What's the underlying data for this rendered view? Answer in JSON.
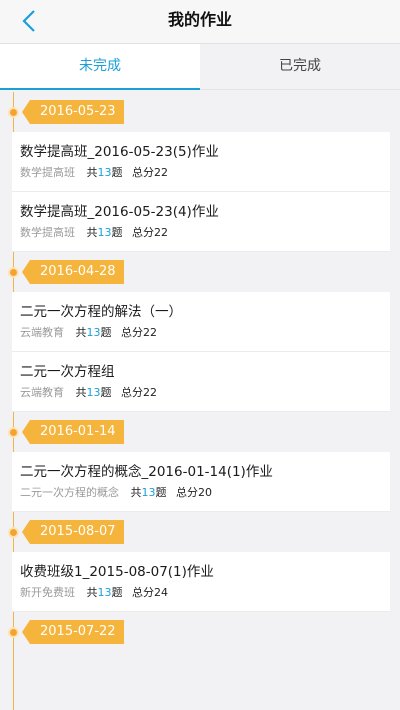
{
  "header": {
    "title": "我的作业"
  },
  "tabs": [
    {
      "label": "未完成",
      "active": true
    },
    {
      "label": "已完成",
      "active": false
    }
  ],
  "colors": {
    "accent": "#1aa0d8",
    "date_badge": "#f5b43b"
  },
  "icons": {
    "back": "chevron-left-icon"
  },
  "groups": [
    {
      "date": "2016-05-23",
      "items": [
        {
          "title": "数学提高班_2016-05-23(5)作业",
          "source": "数学提高班",
          "count_prefix": "共",
          "count": "13",
          "count_suffix": "题",
          "score": "总分22"
        },
        {
          "title": "数学提高班_2016-05-23(4)作业",
          "source": "数学提高班",
          "count_prefix": "共",
          "count": "13",
          "count_suffix": "题",
          "score": "总分22"
        }
      ]
    },
    {
      "date": "2016-04-28",
      "items": [
        {
          "title": "二元一次方程的解法（一）",
          "source": "云端教育",
          "count_prefix": "共",
          "count": "13",
          "count_suffix": "题",
          "score": "总分22"
        },
        {
          "title": "二元一次方程组",
          "source": "云端教育",
          "count_prefix": "共",
          "count": "13",
          "count_suffix": "题",
          "score": "总分22"
        }
      ]
    },
    {
      "date": "2016-01-14",
      "items": [
        {
          "title": "二元一次方程的概念_2016-01-14(1)作业",
          "source": "二元一次方程的概念",
          "count_prefix": "共",
          "count": "13",
          "count_suffix": "题",
          "score": "总分20"
        }
      ]
    },
    {
      "date": "2015-08-07",
      "items": [
        {
          "title": "收费班级1_2015-08-07(1)作业",
          "source": "新开免费班",
          "count_prefix": "共",
          "count": "13",
          "count_suffix": "题",
          "score": "总分24"
        }
      ]
    },
    {
      "date": "2015-07-22",
      "items": []
    }
  ]
}
